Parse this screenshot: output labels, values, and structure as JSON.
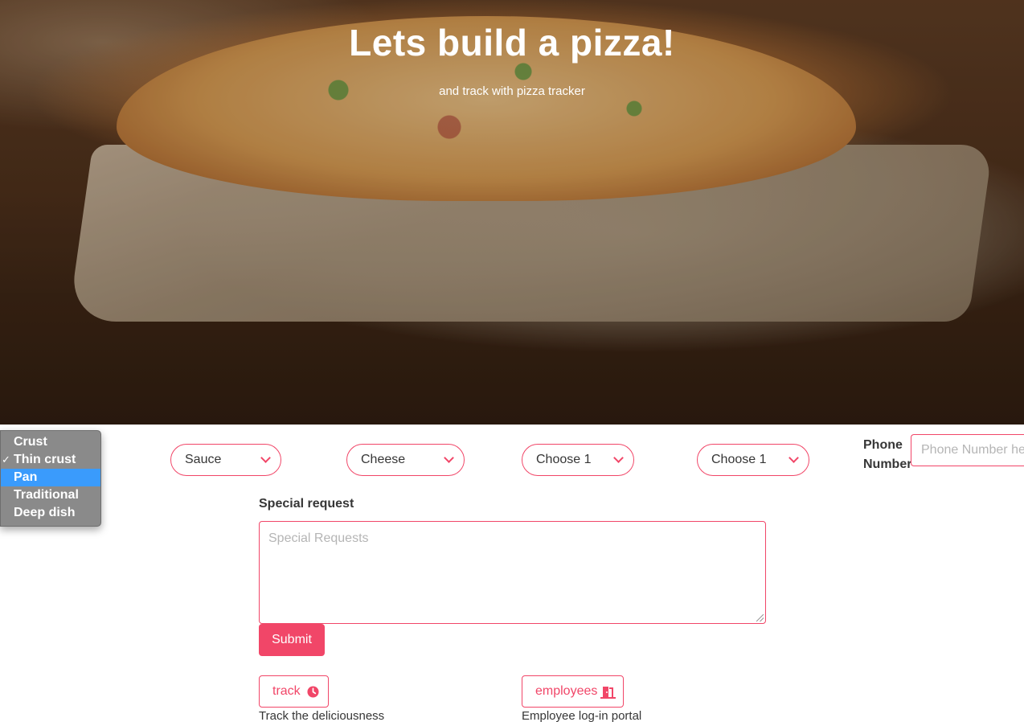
{
  "hero": {
    "title": "Lets build a pizza!",
    "subtitle": "and track with pizza tracker"
  },
  "form": {
    "crust_dropdown": {
      "options": [
        "Crust",
        "Thin crust",
        "Pan",
        "Traditional",
        "Deep dish"
      ],
      "checked": "Thin crust",
      "highlighted": "Pan"
    },
    "sauce_select": {
      "value": "Sauce"
    },
    "cheese_select": {
      "value": "Cheese"
    },
    "topping_select_1": {
      "value": "Choose 1"
    },
    "topping_select_2": {
      "value": "Choose 1"
    },
    "phone": {
      "label": "Phone Number",
      "placeholder": "Phone Number here"
    },
    "special_request": {
      "label": "Special request",
      "placeholder": "Special Requests"
    },
    "submit_label": "Submit"
  },
  "links": {
    "track": {
      "label": "track",
      "caption": "Track the deliciousness",
      "icon": "clock-icon"
    },
    "employees": {
      "label": "employees",
      "caption": "Employee log-in portal",
      "icon": "door-open-icon"
    }
  },
  "colors": {
    "accent": "#f14668",
    "dropdown_highlight": "#3a9bfc",
    "dropdown_bg": "#8a8a8a"
  }
}
